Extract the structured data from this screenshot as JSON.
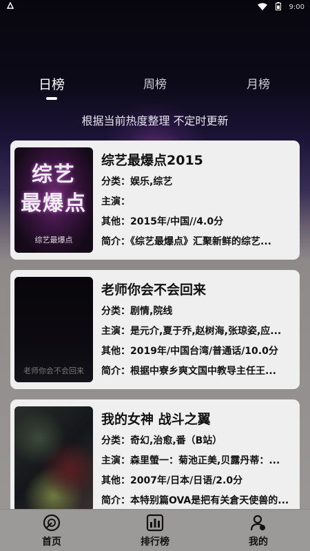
{
  "status_bar": {
    "time": "9:00"
  },
  "tabs": [
    {
      "label": "日榜",
      "active": true
    },
    {
      "label": "周榜",
      "active": false
    },
    {
      "label": "月榜",
      "active": false
    }
  ],
  "subtitle": "根据当前热度整理 不定时更新",
  "cards": [
    {
      "title": "综艺最爆点2015",
      "category": "分类：娱乐,综艺",
      "cast": "主演：",
      "other": "其他：2015年/中国//4.0分",
      "intro": "简介：《综艺最爆点》汇聚新鲜的综艺...",
      "poster": {
        "line1": "综艺",
        "line2": "最爆点",
        "small": "综艺最爆点"
      }
    },
    {
      "title": "老师你会不会回来",
      "category": "分类：剧情,院线",
      "cast": "主演：是元介,夏于乔,赵树海,张琼姿,应...",
      "other": "其他：2019年/中国台湾/普通话/10.0分",
      "intro": "简介：根据中寮乡爽文国中教导主任王...",
      "poster": {
        "small": "老师你会不会回来"
      }
    },
    {
      "title": "我的女神 战斗之翼",
      "category": "分类：奇幻,治愈,番（B站）",
      "cast": "主演：森里螢一：菊池正美,贝露丹蒂：...",
      "other": "其他：2007年/日本/日语/2.0分",
      "intro": "简介：本特别篇OVA是把有关倉天使兽的..."
    }
  ],
  "bottom_nav": [
    {
      "label": "首页",
      "icon": "home-icon"
    },
    {
      "label": "排行榜",
      "icon": "ranking-icon"
    },
    {
      "label": "我的",
      "icon": "profile-icon"
    }
  ]
}
